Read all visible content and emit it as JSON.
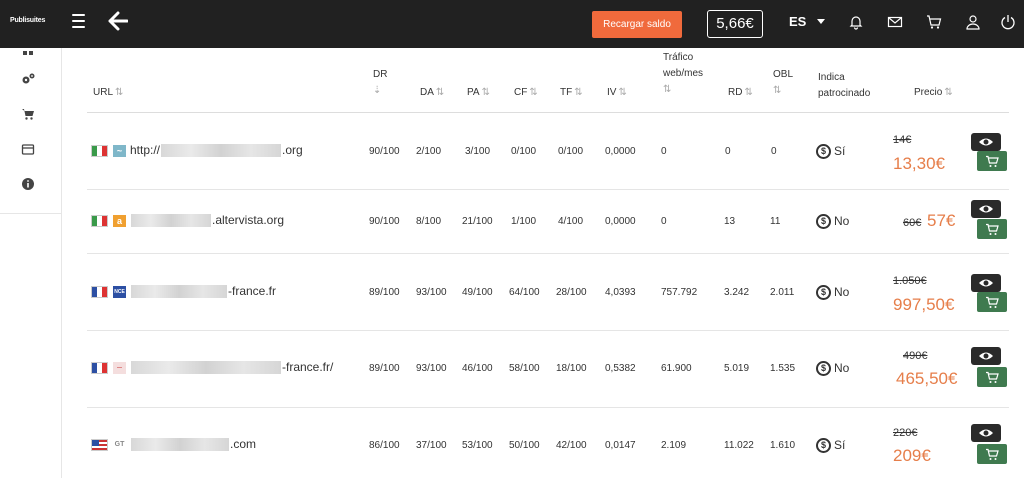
{
  "topbar": {
    "logo": "Publisuites",
    "recharge_label": "Recargar saldo",
    "balance": "5,66€",
    "language": "ES"
  },
  "table": {
    "headers": {
      "url": "URL",
      "dr": "DR",
      "da": "DA",
      "pa": "PA",
      "cf": "CF",
      "tf": "TF",
      "iv": "IV",
      "traffic_line1": "Tráfico",
      "traffic_line2": "web/mes",
      "rd": "RD",
      "obl": "OBL",
      "sponsored_line1": "Indica",
      "sponsored_line2": "patrocinado",
      "price": "Precio"
    },
    "rows": [
      {
        "flag": "IT",
        "url_prefix": "http://",
        "url_suffix": ".org",
        "dr": "90/100",
        "da": "2/100",
        "pa": "3/100",
        "cf": "0/100",
        "tf": "0/100",
        "iv": "0,0000",
        "traffic": "0",
        "rd": "0",
        "obl": "0",
        "sponsored": "Sí",
        "old_price": "14€",
        "price": "13,30€"
      },
      {
        "flag": "IT",
        "url_prefix": "",
        "url_suffix": ".altervista.org",
        "dr": "90/100",
        "da": "8/100",
        "pa": "21/100",
        "cf": "1/100",
        "tf": "4/100",
        "iv": "0,0000",
        "traffic": "0",
        "rd": "13",
        "obl": "11",
        "sponsored": "No",
        "old_price": "60€",
        "price": "57€"
      },
      {
        "flag": "FR",
        "url_prefix": "",
        "url_suffix": "-france.fr",
        "dr": "89/100",
        "da": "93/100",
        "pa": "49/100",
        "cf": "64/100",
        "tf": "28/100",
        "iv": "4,0393",
        "traffic": "757.792",
        "rd": "3.242",
        "obl": "2.011",
        "sponsored": "No",
        "old_price": "1.050€",
        "price": "997,50€"
      },
      {
        "flag": "FR",
        "url_prefix": "",
        "url_suffix": "-france.fr/",
        "dr": "89/100",
        "da": "93/100",
        "pa": "46/100",
        "cf": "58/100",
        "tf": "18/100",
        "iv": "0,5382",
        "traffic": "61.900",
        "rd": "5.019",
        "obl": "1.535",
        "sponsored": "No",
        "old_price": "490€",
        "price": "465,50€"
      },
      {
        "flag": "US",
        "url_prefix": "",
        "url_suffix": ".com",
        "dr": "86/100",
        "da": "37/100",
        "pa": "53/100",
        "cf": "50/100",
        "tf": "42/100",
        "iv": "0,0147",
        "traffic": "2.109",
        "rd": "11.022",
        "obl": "1.610",
        "sponsored": "Sí",
        "old_price": "220€",
        "price": "209€"
      }
    ]
  },
  "colors": {
    "accent": "#f06a3c",
    "price": "#e67e4a",
    "cart_button": "#3f7a4f",
    "topbar": "#212121"
  }
}
